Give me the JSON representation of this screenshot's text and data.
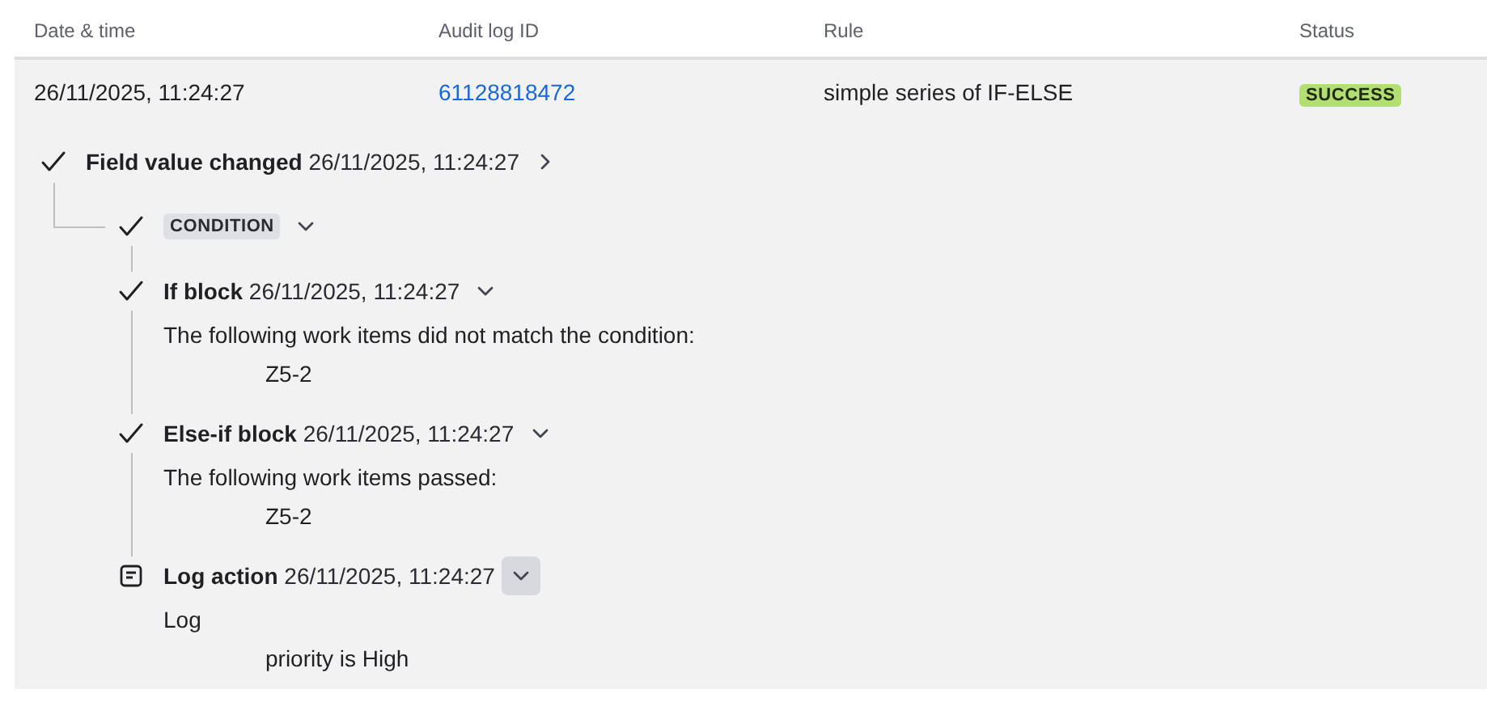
{
  "table": {
    "columns": [
      "Date & time",
      "Audit log ID",
      "Rule",
      "Status"
    ],
    "rows": [
      {
        "date": "26/11/2025, 11:24:27",
        "audit_id": "61128818472",
        "rule": "simple series of IF-ELSE",
        "status": {
          "label": "SUCCESS",
          "kind": "success"
        },
        "trace": [
          {
            "kind": "trigger",
            "label": "Field value changed",
            "time": "26/11/2025, 11:24:27",
            "expanded": false,
            "hovered": false,
            "children": [
              {
                "kind": "condition",
                "label": "CONDITION",
                "expanded": true,
                "hovered": false,
                "children": [
                  {
                    "kind": "branch",
                    "label": "If block",
                    "time": "26/11/2025, 11:24:27",
                    "expanded": true,
                    "hovered": false,
                    "details": [
                      {
                        "text": "The following work items did not match the condition:",
                        "items": [
                          "Z5-2"
                        ]
                      }
                    ]
                  },
                  {
                    "kind": "branch",
                    "label": "Else-if block",
                    "time": "26/11/2025, 11:24:27",
                    "expanded": true,
                    "hovered": false,
                    "details": [
                      {
                        "text": "The following work items passed:",
                        "items": [
                          "Z5-2"
                        ]
                      }
                    ]
                  },
                  {
                    "kind": "action",
                    "label": "Log action",
                    "time": "26/11/2025, 11:24:27",
                    "expanded": true,
                    "hovered": true,
                    "details": [
                      {
                        "text": "Log",
                        "items": [
                          "priority is High"
                        ]
                      }
                    ]
                  }
                ]
              }
            ]
          }
        ]
      }
    ]
  }
}
